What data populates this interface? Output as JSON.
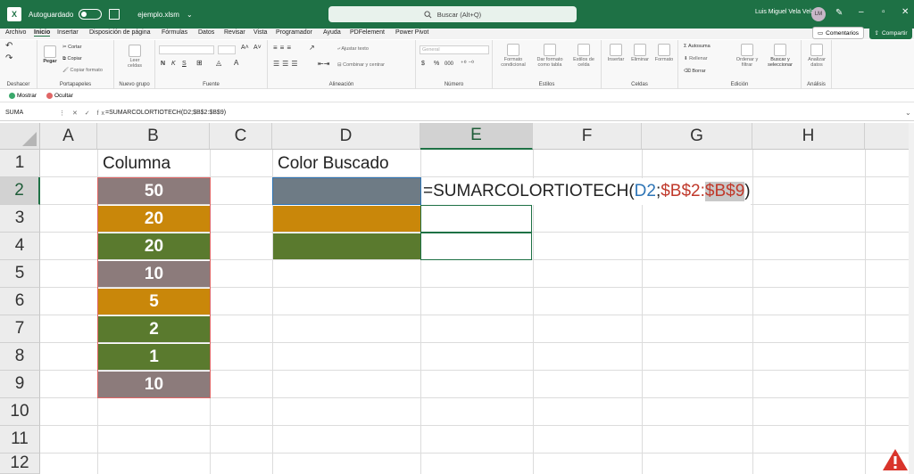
{
  "titlebar": {
    "logo": "X",
    "autosave_label": "Autoguardado",
    "file_name": "ejemplo.xlsm",
    "file_chevron": "⌄",
    "search_placeholder": "Buscar (Alt+Q)",
    "user_name": "Luis Miguel Vela Vela",
    "user_initials": "LM",
    "icons": [
      "excel-logo-icon",
      "save-icon",
      "search-icon",
      "pen-icon",
      "minimize-icon",
      "restore-icon",
      "close-icon"
    ]
  },
  "menu": {
    "items": [
      "Archivo",
      "Inicio",
      "Insertar",
      "Disposición de página",
      "Fórmulas",
      "Datos",
      "Revisar",
      "Vista",
      "Programador",
      "Ayuda",
      "PDFelement",
      "Power Pivot"
    ],
    "active": "Inicio",
    "comments_label": "Comentarios",
    "share_label": "Compartir"
  },
  "ribbon": {
    "undo_group": "Deshacer",
    "clipboard": {
      "label": "Portapapeles",
      "paste": "Pegar",
      "cut": "Cortar",
      "copy": "Copiar",
      "format_painter": "Copiar formato"
    },
    "new_group": {
      "label": "Nuevo grupo",
      "button": "Leer celdas"
    },
    "font": {
      "label": "Fuente",
      "bold": "N",
      "italic": "K",
      "underline": "S"
    },
    "alignment": {
      "label": "Alineación",
      "wrap": "Ajustar texto",
      "merge": "Combinar y centrar"
    },
    "number": {
      "label": "Número",
      "format": "General",
      "currency": "$",
      "percent": "%",
      "thousands": "000"
    },
    "styles": {
      "label": "Estilos",
      "conditional": "Formato condicional",
      "table": "Dar formato como tabla",
      "cell_styles": "Estilos de celda"
    },
    "cells": {
      "label": "Celdas",
      "insert": "Insertar",
      "delete": "Eliminar",
      "format": "Formato"
    },
    "editing": {
      "label": "Edición",
      "autosum": "Autosuma",
      "fill": "Rellenar",
      "clear": "Borrar",
      "sort": "Ordenar y filtrar",
      "find": "Buscar y seleccionar"
    },
    "analysis": {
      "label": "Análisis",
      "analyze": "Analizar datos"
    }
  },
  "showbar": {
    "show_label": "Mostrar",
    "hide_label": "Ocultar",
    "show_color": "#3aa86b",
    "hide_color": "#e06666"
  },
  "formula_bar": {
    "name_box": "SUMA",
    "controls": "⋮ ✕ ✓ fx",
    "formula": "=SUMARCOLORTIOTECH(D2;$B$2:$B$9)"
  },
  "sheet": {
    "columns": [
      "A",
      "B",
      "C",
      "D",
      "E",
      "F",
      "G",
      "H"
    ],
    "selected_column": "E",
    "rows": [
      "1",
      "2",
      "3",
      "4",
      "5",
      "6",
      "7",
      "8",
      "9",
      "10",
      "11",
      "12"
    ],
    "selected_row": "2",
    "b1": "Columna",
    "d1": "Color Buscado",
    "b_values": [
      "50",
      "20",
      "20",
      "10",
      "5",
      "2",
      "1",
      "10"
    ],
    "b_colors": [
      "#8c7b7b",
      "#c9870a",
      "#5a7a2e",
      "#8c7b7b",
      "#c9870a",
      "#5a7a2e",
      "#5a7a2e",
      "#8c7b7b"
    ],
    "d_colors": [
      "#6e7b85",
      "#c9870a",
      "#5a7a2e"
    ],
    "formula_parts": {
      "fn": "=SUMARCOLORTIOTECH(",
      "ref1": "D2",
      "sep": ";",
      "ref2": "$B$2:",
      "ref3": "$B$9",
      "close": ")"
    }
  },
  "colors": {
    "excel_green": "#1e7145",
    "range_red": "#e06666",
    "warning_red": "#d9342b"
  }
}
